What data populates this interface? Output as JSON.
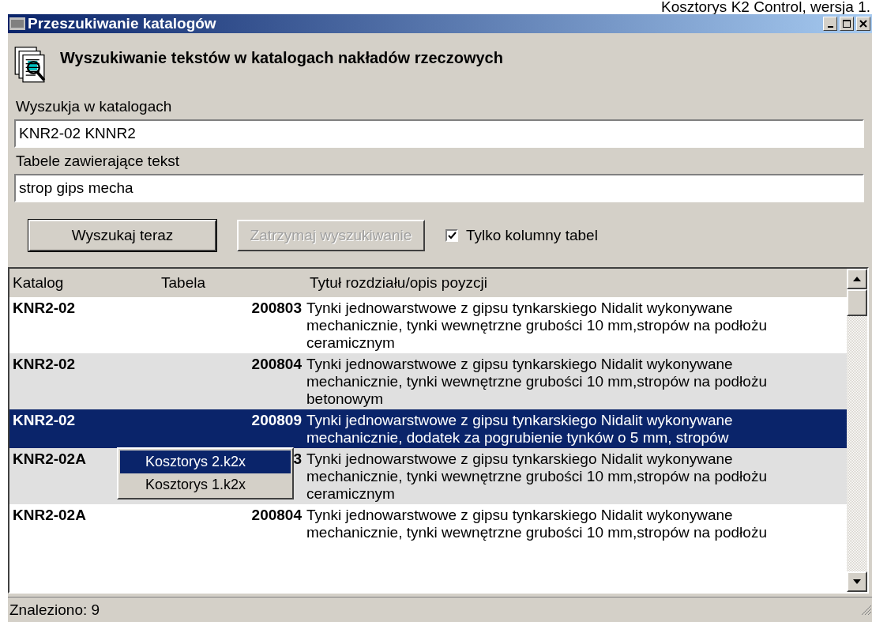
{
  "app_caption": "Kosztorys K2 Control, wersja 1.",
  "window": {
    "title": "Przeszukiwanie katalogów"
  },
  "heading": "Wyszukiwanie tekstów w katalogach nakładów rzeczowych",
  "fields": [
    {
      "label": "Wyszukja w katalogach",
      "value": "KNR2-02 KNNR2"
    },
    {
      "label": "Tabele zawierające tekst",
      "value": "strop gips mecha"
    }
  ],
  "buttons": [
    {
      "label": "Wyszukaj teraz",
      "disabled": false
    },
    {
      "label": "Zatrzymaj wyszukiwanie",
      "disabled": true
    }
  ],
  "checkbox": {
    "label": "Tylko kolumny tabel",
    "checked": true
  },
  "table": {
    "columns": [
      "Katalog",
      "Tabela",
      "Tytuł rozdziału/opis poyzcji"
    ],
    "rows": [
      {
        "katalog": "KNR2-02",
        "tabela": "200803",
        "opis": "Tynki jednowarstwowe z gipsu tynkarskiego Nidalit wykonywane mechanicznie, tynki wewnętrzne grubości 10 mm,stropów na podłożu ceramicznym",
        "selected": false
      },
      {
        "katalog": "KNR2-02",
        "tabela": "200804",
        "opis": "Tynki jednowarstwowe z gipsu tynkarskiego Nidalit wykonywane mechanicznie, tynki wewnętrzne grubości 10 mm,stropów na podłożu betonowym",
        "selected": false
      },
      {
        "katalog": "KNR2-02",
        "tabela": "200809",
        "opis": "Tynki jednowarstwowe z gipsu tynkarskiego Nidalit wykonywane mechanicznie, dodatek za pogrubienie tynków o 5 mm, stropów",
        "selected": true
      },
      {
        "katalog": "KNR2-02A",
        "tabela": "3",
        "opis": "Tynki jednowarstwowe z gipsu tynkarskiego Nidalit wykonywane mechanicznie, tynki wewnętrzne grubości 10 mm,stropów na podłożu ceramicznym",
        "selected": false
      },
      {
        "katalog": "KNR2-02A",
        "tabela": "200804",
        "opis": "Tynki jednowarstwowe z gipsu tynkarskiego Nidalit wykonywane mechanicznie, tynki wewnętrzne grubości 10 mm,stropów na podłożu",
        "selected": false
      }
    ]
  },
  "popup_menu": [
    {
      "label": "Kosztorys 2.k2x",
      "selected": true
    },
    {
      "label": "Kosztorys 1.k2x",
      "selected": false
    }
  ],
  "status_bar": "Znaleziono: 9"
}
